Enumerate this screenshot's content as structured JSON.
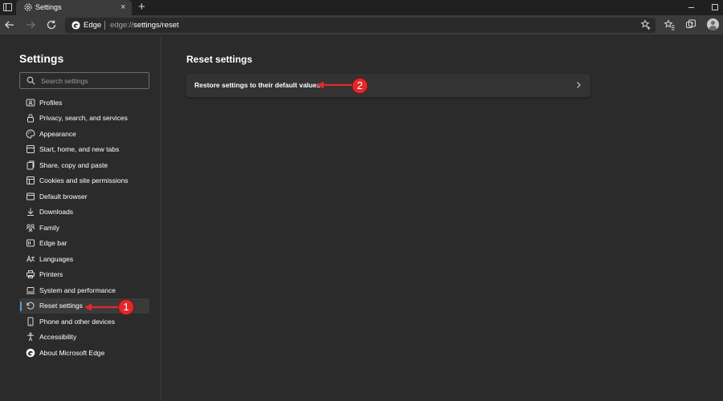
{
  "tab": {
    "title": "Settings",
    "close": "×",
    "new_tab": "+"
  },
  "address_bar": {
    "brand": "Edge",
    "url_prefix": "edge://",
    "url_path": "settings/reset"
  },
  "sidebar": {
    "title": "Settings",
    "search_placeholder": "Search settings",
    "items": [
      {
        "label": "Profiles",
        "icon": "profile-icon"
      },
      {
        "label": "Privacy, search, and services",
        "icon": "lock-icon"
      },
      {
        "label": "Appearance",
        "icon": "palette-icon"
      },
      {
        "label": "Start, home, and new tabs",
        "icon": "home-icon"
      },
      {
        "label": "Share, copy and paste",
        "icon": "share-icon"
      },
      {
        "label": "Cookies and site permissions",
        "icon": "cookie-icon"
      },
      {
        "label": "Default browser",
        "icon": "browser-icon"
      },
      {
        "label": "Downloads",
        "icon": "download-icon"
      },
      {
        "label": "Family",
        "icon": "family-icon"
      },
      {
        "label": "Edge bar",
        "icon": "edge-bar-icon"
      },
      {
        "label": "Languages",
        "icon": "language-icon"
      },
      {
        "label": "Printers",
        "icon": "printer-icon"
      },
      {
        "label": "System and performance",
        "icon": "laptop-icon"
      },
      {
        "label": "Reset settings",
        "icon": "reset-icon",
        "active": true
      },
      {
        "label": "Phone and other devices",
        "icon": "phone-icon"
      },
      {
        "label": "Accessibility",
        "icon": "accessibility-icon"
      },
      {
        "label": "About Microsoft Edge",
        "icon": "edge-logo-icon"
      }
    ]
  },
  "main": {
    "title": "Reset settings",
    "card_label": "Restore settings to their default values"
  },
  "annotations": [
    {
      "number": "1"
    },
    {
      "number": "2"
    }
  ],
  "colors": {
    "accent": "#4aa3e8",
    "annotation_red": "#e02a2a",
    "background": "#2b2b2b"
  }
}
